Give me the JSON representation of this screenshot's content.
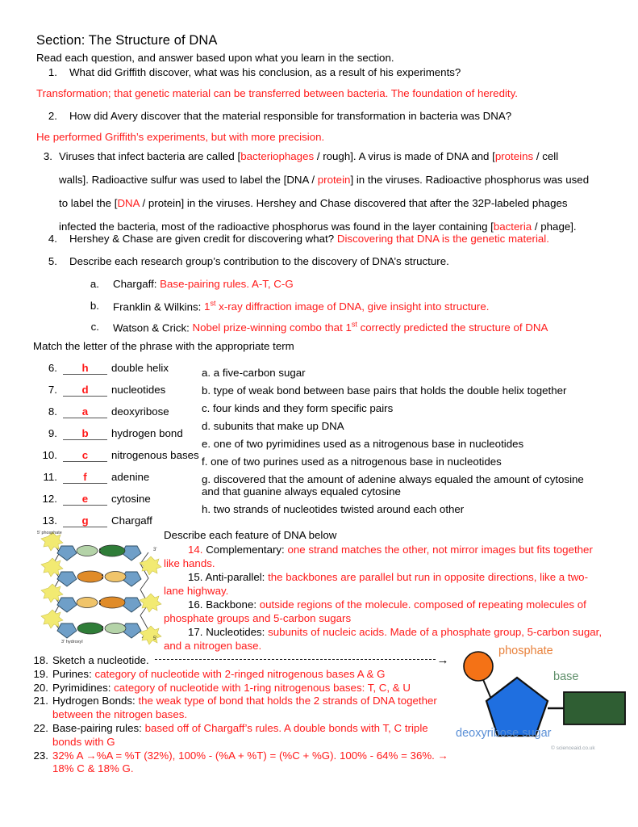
{
  "document": {
    "title": "Section: The Structure of DNA",
    "instructions": "Read each question, and answer based upon what you learn in the section."
  },
  "colors": {
    "answer_red": "#ff1a1a",
    "text_black": "#000000",
    "phosphate_orange": "#f47216",
    "sugar_blue": "#1f6fe0",
    "base_green": "#2f5e33"
  },
  "questions": [
    {
      "number": "1.",
      "prompt": "What did Griffith discover, what was his conclusion, as a result of his experiments?",
      "answer": "Transformation; that genetic material can be transferred between bacteria. The foundation of heredity."
    },
    {
      "number": "2.",
      "prompt": "How did Avery discover that the material responsible for transformation in bacteria was DNA?",
      "answer": "He performed Griffith’s experiments, but with more precision."
    }
  ],
  "question3": {
    "number": "3.",
    "lines": [
      [
        {
          "t": "Viruses that infect bacteria are called [",
          "c": "blk"
        },
        {
          "t": "bacteriophages",
          "c": "red"
        },
        {
          "t": " / rough]. A virus is made of DNA and [",
          "c": "blk"
        },
        {
          "t": "proteins",
          "c": "red"
        },
        {
          "t": " / cell",
          "c": "blk"
        }
      ],
      [
        {
          "t": "walls]. Radioactive sulfur was used to label the [DNA / ",
          "c": "blk"
        },
        {
          "t": "protein",
          "c": "red"
        },
        {
          "t": "] in the viruses. Radioactive phosphorus was used",
          "c": "blk"
        }
      ],
      [
        {
          "t": "to label the [",
          "c": "blk"
        },
        {
          "t": "DNA",
          "c": "red"
        },
        {
          "t": " / protein] in the viruses. Hershey and Chase discovered that after the 32P-labeled phages",
          "c": "blk"
        }
      ],
      [
        {
          "t": "infected the bacteria, most of the radioactive phosphorus was found in the layer containing [",
          "c": "blk"
        },
        {
          "t": "bacteria",
          "c": "red"
        },
        {
          "t": " / phage].",
          "c": "blk"
        }
      ]
    ]
  },
  "question4": {
    "number": "4.",
    "prompt": "Hershey & Chase are given credit for discovering what? ",
    "answer": "Discovering that DNA is the genetic material."
  },
  "question5": {
    "number": "5.",
    "prompt": "Describe each research group’s contribution to the discovery of DNA’s structure.",
    "items": [
      {
        "label": "a.",
        "term": "Chargaff: ",
        "answer_pre": "Base-pairing rules. A-T, C-G",
        "sup": "",
        "answer_post": ""
      },
      {
        "label": "b.",
        "term": "Franklin & Wilkins: ",
        "answer_pre": "1",
        "sup": "st",
        "answer_post": " x-ray diffraction image of DNA, give insight into structure."
      },
      {
        "label": "c.",
        "term": "Watson & Crick: ",
        "answer_pre": "Nobel prize-winning combo that 1",
        "sup": "st",
        "answer_post": " correctly predicted the structure of DNA"
      }
    ]
  },
  "matching": {
    "header": "Match the letter of the phrase with the appropriate term",
    "rows": [
      {
        "number": "6.",
        "answer": "h",
        "term": "double helix"
      },
      {
        "number": "7.",
        "answer": "d",
        "term": "nucleotides"
      },
      {
        "number": "8.",
        "answer": "a",
        "term": "deoxyribose"
      },
      {
        "number": "9.",
        "answer": "b",
        "term": "hydrogen bond"
      },
      {
        "number": "10.",
        "answer": "c",
        "term": "nitrogenous bases"
      },
      {
        "number": "11.",
        "answer": "f",
        "term": "adenine"
      },
      {
        "number": "12.",
        "answer": "e",
        "term": "cytosine"
      },
      {
        "number": "13.",
        "answer": "g",
        "term": "Chargaff"
      }
    ],
    "options": [
      "a. a five-carbon sugar",
      "b. type of weak bond between base pairs that holds the double helix together",
      "c. four kinds and they form specific pairs",
      "d. subunits that make up DNA",
      "e. one of two pyrimidines used as a nitrogenous base in nucleotides",
      "f. one of two purines used as a nitrogenous base in nucleotides",
      "g. discovered that the amount of adenine always equaled the amount of cytosine",
      "and that guanine always equaled cytosine",
      "h. two strands of nucleotides twisted around each other"
    ]
  },
  "describe": {
    "header": "Describe each feature of DNA below",
    "items": [
      {
        "number": "14.",
        "number_color": "red",
        "term": "Complementary: ",
        "answer": "one strand matches the other, not mirror images but fits together like hands."
      },
      {
        "number": "15.",
        "number_color": "blk",
        "term": "Anti-parallel: ",
        "answer": "the backbones are parallel but run in opposite directions, like a two-lane highway."
      },
      {
        "number": "16.",
        "number_color": "blk",
        "term": "Backbone: ",
        "answer": "outside regions of the molecule. composed of repeating molecules of phosphate groups and 5-carbon sugars"
      },
      {
        "number": "17.",
        "number_color": "blk",
        "term": "Nucleotides: ",
        "answer": "subunits of nucleic acids. Made of a phosphate group, 5-carbon sugar, and a nitrogen base."
      }
    ]
  },
  "bottom_list": [
    {
      "number": "18.",
      "term": "Sketch a nucleotide. ",
      "term_color": "blk",
      "answer": "",
      "has_dashed_arrow": true,
      "arrow_glyph": "→"
    },
    {
      "number": "19.",
      "term": "Purines: ",
      "term_color": "blk",
      "answer": "category of nucleotide with 2-ringed nitrogenous bases A & G",
      "has_dashed_arrow": false
    },
    {
      "number": "20.",
      "term": "Pyrimidines: ",
      "term_color": "blk",
      "answer": "category of nucleotide with 1-ring nitrogenous bases: T, C, & U",
      "has_dashed_arrow": false
    },
    {
      "number": "21.",
      "term": "Hydrogen Bonds: ",
      "term_color": "blk",
      "answer": "the weak type of bond that holds the 2 strands of DNA together between the nitrogen bases.",
      "has_dashed_arrow": false
    },
    {
      "number": "22.",
      "term": "Base-pairing rules: ",
      "term_color": "blk",
      "answer": "based off of Chargaff’s rules. A double bonds with T, C triple bonds with G",
      "has_dashed_arrow": false
    },
    {
      "number": "23.",
      "term": "",
      "term_color": "red",
      "answer": "32% A →%A = %T (32%), 100% - (%A + %T) = (%C + %G). 100% - 64% = 36%. → 18% C & 18% G.",
      "has_dashed_arrow": false
    }
  ],
  "ladder_figure": {
    "label_top_left": "5' phosphate",
    "label_top_right": "3'",
    "label_bottom_left": "3' hydroxyl",
    "label_bottom_right": "5'"
  },
  "nucleotide_figure": {
    "label_phosphate": "phosphate",
    "label_base": "base",
    "label_sugar": "deoxyribose sugar",
    "credit": "© scienceaid.co.uk"
  }
}
